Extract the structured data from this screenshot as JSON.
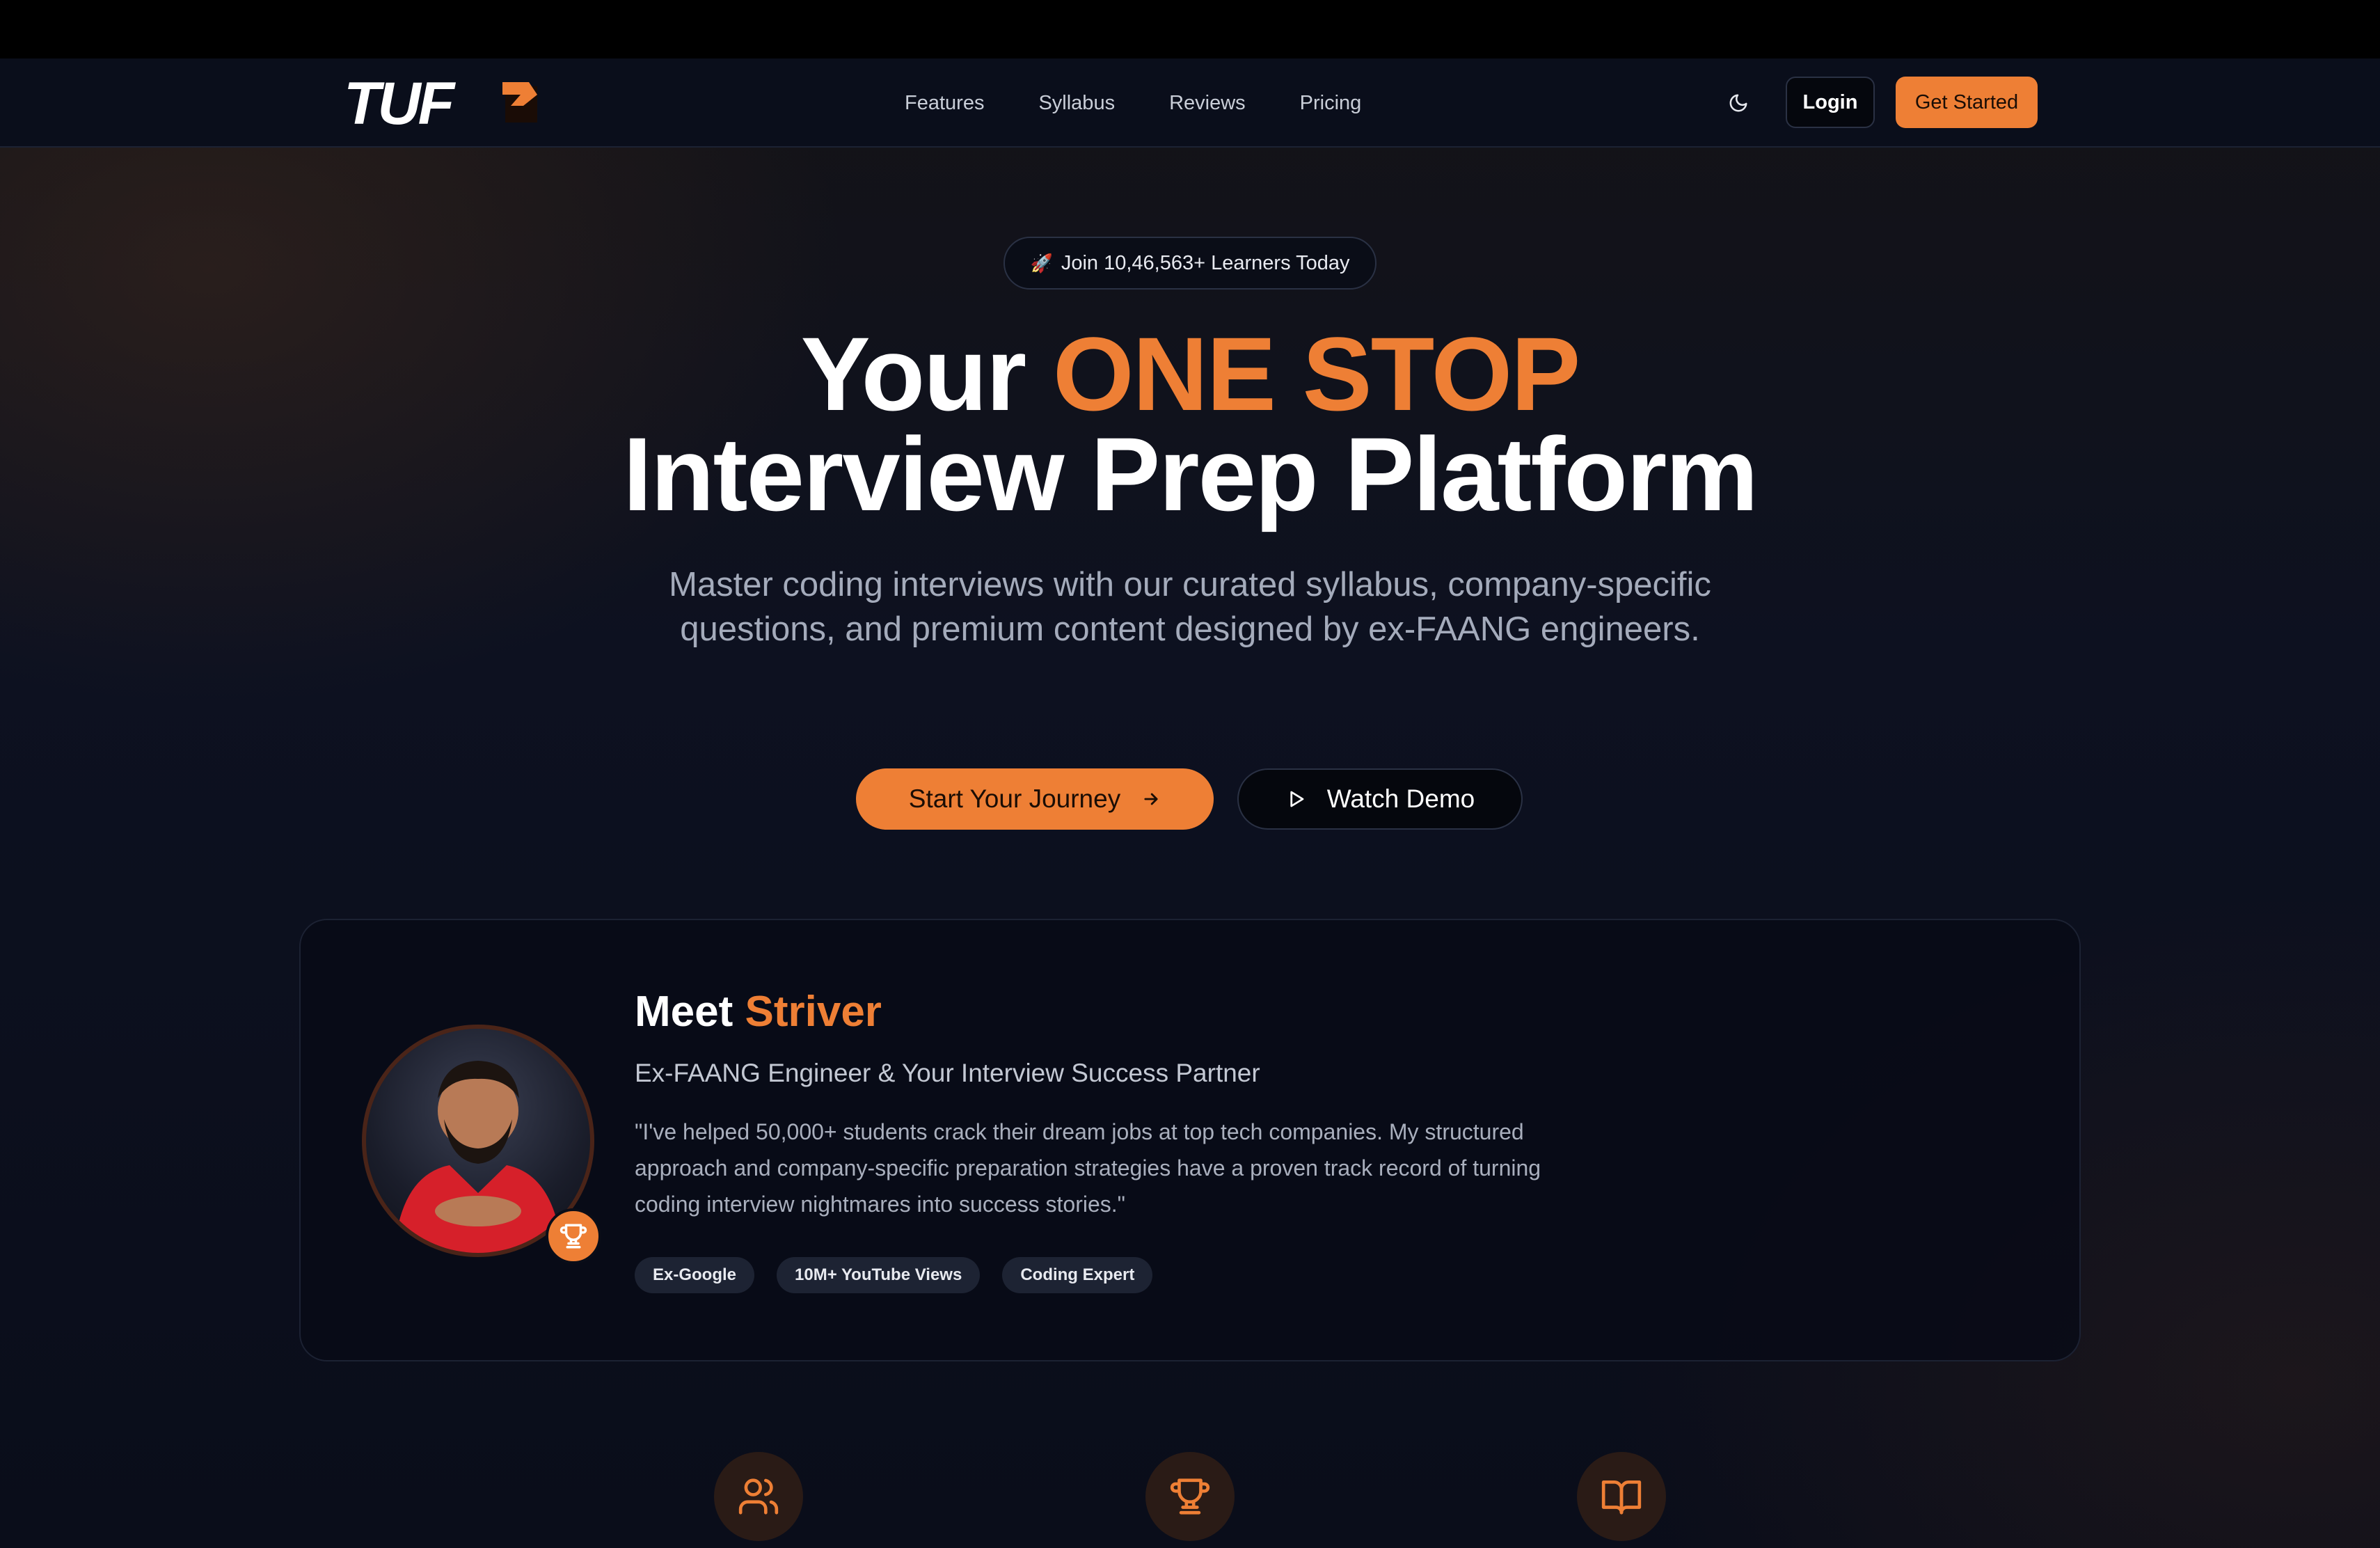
{
  "brand": {
    "logo_text": "TUF",
    "accent_color": "#ee7f35"
  },
  "nav": {
    "links": [
      "Features",
      "Syllabus",
      "Reviews",
      "Pricing"
    ],
    "theme_icon": "moon-icon",
    "login_label": "Login",
    "get_started_label": "Get Started"
  },
  "hero": {
    "badge_emoji": "🚀",
    "badge_text": "Join 10,46,563+ Learners Today",
    "title_part1": "Your ",
    "title_accent": "ONE STOP",
    "title_line2": "Interview Prep Platform",
    "subtitle": "Master coding interviews with our curated syllabus, company-specific questions, and premium content designed by ex-FAANG engineers.",
    "cta_primary": "Start Your Journey",
    "cta_secondary": "Watch Demo"
  },
  "mentor": {
    "heading_prefix": "Meet ",
    "heading_name": "Striver",
    "role": "Ex-FAANG Engineer & Your Interview Success Partner",
    "quote": "\"I've helped 50,000+ students crack their dream jobs at top tech companies. My structured approach and company-specific preparation strategies have a proven track record of turning coding interview nightmares into success stories.\"",
    "tags": [
      "Ex-Google",
      "10M+ YouTube Views",
      "Coding Expert"
    ],
    "badge_icon": "trophy-icon"
  },
  "features_icons": [
    "users-icon",
    "trophy-icon",
    "book-open-icon"
  ]
}
